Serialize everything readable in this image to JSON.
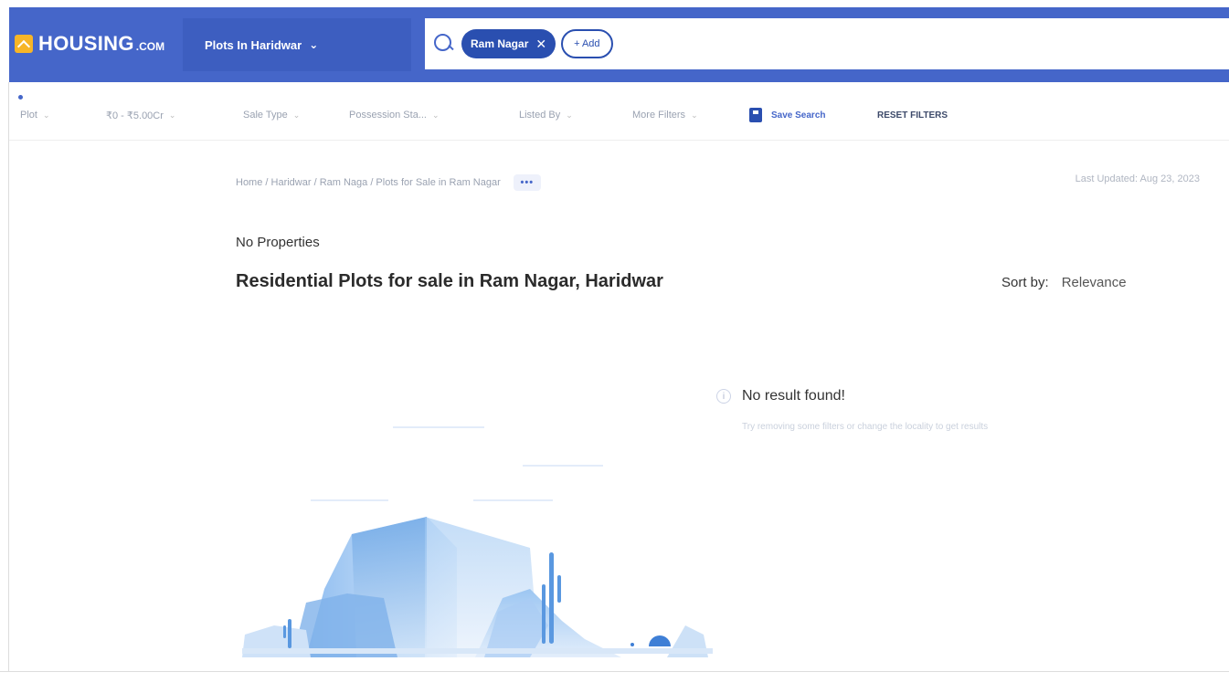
{
  "header": {
    "logo_text": "HOUSING",
    "logo_suffix": ".COM",
    "city_select": "Plots In Haridwar",
    "search_chip": "Ram Nagar",
    "add_label": "+ Add"
  },
  "filters": [
    {
      "label": "Plot"
    },
    {
      "label": "₹0 - ₹5.00Cr"
    },
    {
      "label": "Sale Type"
    },
    {
      "label": "Possession Sta..."
    },
    {
      "label": "Listed By"
    },
    {
      "label": "More Filters"
    }
  ],
  "actions": {
    "save_search": "Save Search",
    "reset_filters": "RESET FILTERS"
  },
  "breadcrumb": "Home / Haridwar / Ram Naga  / Plots for Sale in Ram Nagar",
  "breadcrumb_more": "•••",
  "last_updated": "Last Updated: Aug 23, 2023",
  "no_properties": "No Properties",
  "page_title": "Residential Plots for sale in Ram Nagar, Haridwar",
  "sort": {
    "label": "Sort by:",
    "value": "Relevance"
  },
  "empty_state": {
    "title": "No result found!",
    "subtitle": "Try removing some filters or change the locality to get results"
  },
  "colors": {
    "brand_blue": "#4566c9",
    "chip_blue": "#2a4fb0",
    "logo_yellow": "#f7b527"
  }
}
